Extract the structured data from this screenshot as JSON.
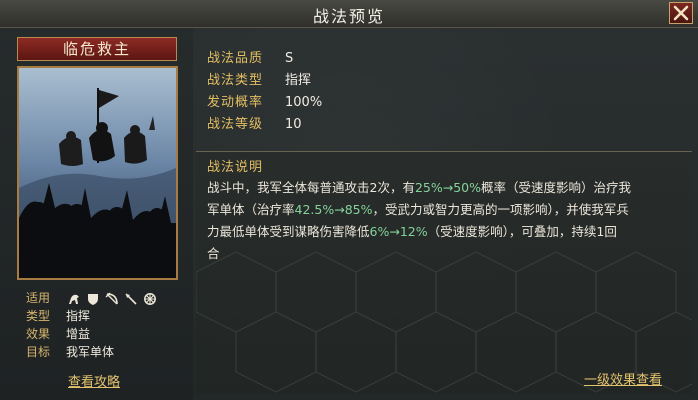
{
  "window": {
    "title": "战法预览"
  },
  "card": {
    "name": "临危救主"
  },
  "left_info": {
    "suitable_label": "适用",
    "type_label": "类型",
    "type_value": "指挥",
    "effect_label": "效果",
    "effect_value": "增益",
    "target_label": "目标",
    "target_value": "我军单体",
    "guide_link": "查看攻略",
    "suitable_icons": [
      "cavalry-icon",
      "shield-icon",
      "bow-icon",
      "spear-icon",
      "wheel-icon"
    ]
  },
  "stats": {
    "quality_label": "战法品质",
    "quality_value": "S",
    "type_label": "战法类型",
    "type_value": "指挥",
    "chance_label": "发动概率",
    "chance_value": "100%",
    "level_label": "战法等级",
    "level_value": "10"
  },
  "description": {
    "title": "战法说明",
    "line1_a": "战斗中，我军全体每普通攻击2次，有",
    "line1_hl": "25%→50%",
    "line1_b": "概率（受速度影响）治疗我",
    "line2_a": "军单体（治疗率",
    "line2_hl": "42.5%→85%",
    "line2_b": "，受武力或智力更高的一项影响），并使我军兵",
    "line3_a": "力最低单体受到谋略伤害降低",
    "line3_hl": "6%→12%",
    "line3_b": "（受速度影响），可叠加，持续1回",
    "line4": "合",
    "effect_link": "一级效果查看"
  },
  "colors": {
    "gold": "#e3bf63",
    "highlight_green": "#84d29a",
    "plate_red": "#8d2a24"
  }
}
